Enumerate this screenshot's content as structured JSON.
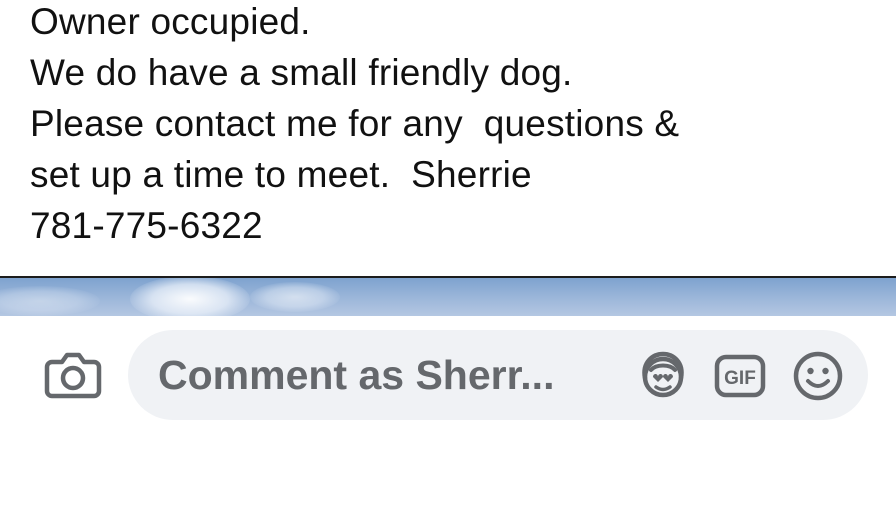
{
  "post": {
    "lines": [
      "Owner occupied.",
      "We do have a small friendly dog.",
      "Please contact me for any  questions &",
      "set up a time to meet.  Sherrie",
      "781-775-6322"
    ]
  },
  "comment_composer": {
    "placeholder": "Comment as Sherr...",
    "icons": {
      "camera": "camera-icon",
      "avatar_sticker": "avatar-sticker-icon",
      "gif": "gif-icon",
      "emoji": "emoji-icon"
    },
    "gif_label": "GIF"
  },
  "colors": {
    "post_text": "#111111",
    "placeholder": "#65686c",
    "pill_background": "#f0f2f5",
    "icon": "#65686c"
  }
}
